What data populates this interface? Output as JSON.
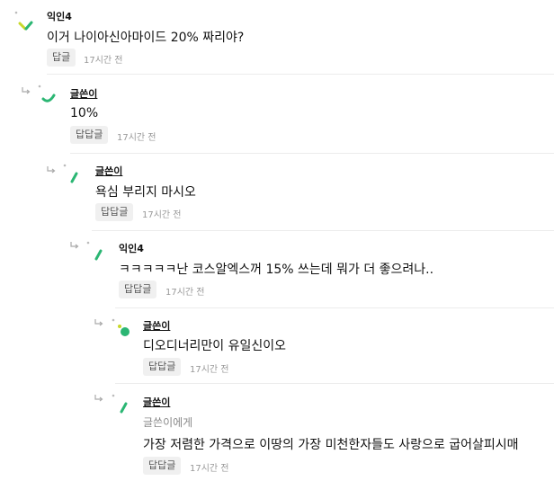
{
  "comments": [
    {
      "author": "익인4",
      "body": "이거 나이아신아마이드 20% 짜리야?",
      "reply_label": "답글",
      "time": "17시간 전"
    },
    {
      "author": "글쓴이",
      "body": "10%",
      "reply_label": "답답글",
      "time": "17시간 전"
    },
    {
      "author": "글쓴이",
      "body": "욕심 부리지 마시오",
      "reply_label": "답답글",
      "time": "17시간 전"
    },
    {
      "author": "익인4",
      "body": "ㅋㅋㅋㅋㅋ난 코스알엑스꺼 15% 쓰는데 뭐가 더 좋으려나..",
      "reply_label": "답답글",
      "time": "17시간 전"
    },
    {
      "author": "글쓴이",
      "body": "디오디너리만이 유일신이오",
      "reply_label": "답답글",
      "time": "17시간 전"
    },
    {
      "author": "글쓴이",
      "recipient": "글쓴이에게",
      "body": "가장 저렴한 가격으로 이땅의 가장 미천한자들도 사랑으로 굽어살피시매",
      "reply_label": "답답글",
      "time": "17시간 전"
    }
  ],
  "colors": {
    "avatar_green": "#2bb673",
    "avatar_lime": "#c8d82a",
    "reply_button_bg": "#f0f0f0",
    "divider": "#ececec"
  }
}
